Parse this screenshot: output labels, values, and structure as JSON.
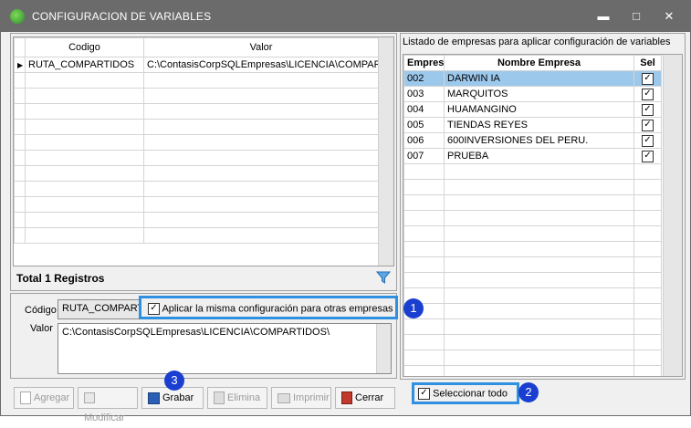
{
  "window": {
    "title": "CONFIGURACION DE VARIABLES"
  },
  "left_grid": {
    "columns": [
      "Codigo",
      "Valor"
    ],
    "rows": [
      {
        "codigo": "RUTA_COMPARTIDOS",
        "valor": "C:\\ContasisCorpSQLEmpresas\\LICENCIA\\COMPARTIDOS\\"
      }
    ]
  },
  "total_label": "Total 1 Registros",
  "form": {
    "codigo_label": "Código",
    "codigo_value": "RUTA_COMPART",
    "apply_checkbox_label": "Aplicar la misma configuración para otras empresas",
    "valor_label": "Valor",
    "valor_value": "C:\\ContasisCorpSQLEmpresas\\LICENCIA\\COMPARTIDOS\\"
  },
  "right_panel": {
    "title": "Listado de empresas para aplicar configuración de variables",
    "columns": [
      "Empresa",
      "Nombre Empresa",
      "Sel"
    ],
    "rows": [
      {
        "empresa": "002",
        "nombre": "DARWIN IA",
        "sel": true
      },
      {
        "empresa": "003",
        "nombre": "MARQUITOS",
        "sel": true
      },
      {
        "empresa": "004",
        "nombre": "HUAMANGINO",
        "sel": true
      },
      {
        "empresa": "005",
        "nombre": "TIENDAS REYES",
        "sel": true
      },
      {
        "empresa": "006",
        "nombre": "600INVERSIONES DEL PERU.",
        "sel": true
      },
      {
        "empresa": "007",
        "nombre": "PRUEBA",
        "sel": true
      }
    ],
    "select_all_label": "Seleccionar todo"
  },
  "toolbar": {
    "agregar": "Agregar",
    "modificar": "Modificar",
    "grabar": "Grabar",
    "elimina": "Elimina",
    "imprimir": "Imprimir",
    "cerrar": "Cerrar"
  },
  "badges": [
    "1",
    "2",
    "3"
  ],
  "colors": {
    "titlebar": "#6b6b6b",
    "highlight": "#2f8fe0",
    "badge": "#1a3fd0",
    "selected_row": "#9cc8ec"
  }
}
